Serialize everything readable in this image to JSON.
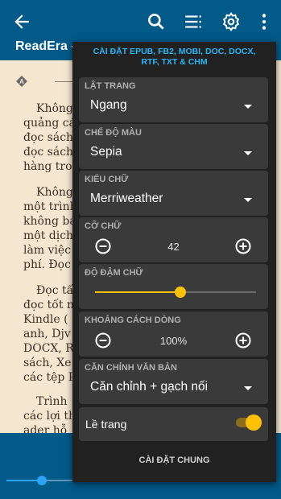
{
  "app_bar": {
    "title": "ReadEra –"
  },
  "book": {
    "lines": [
      "Không",
      "quảng cá",
      "đọc sách",
      "đọc sách",
      "hàng trong",
      "Không",
      "một trình",
      "không bá",
      "một dịch",
      "làm việc",
      "phí. Đọc",
      "Đọc tấ",
      "đọc tốt n",
      "Kindle (",
      "anh, Djv",
      "DOCX, R",
      "sách, Xe",
      "các tệp P",
      "Trình",
      "các lợi th",
      "ader hỗ"
    ]
  },
  "panel": {
    "header": "CÀI ĐẶT EPUB, FB2, MOBI, DOC, DOCX, RTF, TXT & CHM",
    "page_turn": {
      "label": "LẬT TRANG",
      "value": "Ngang"
    },
    "color_mode": {
      "label": "CHẾ ĐỘ MÀU",
      "value": "Sepia"
    },
    "font": {
      "label": "KIỂU CHỮ",
      "value": "Merriweather"
    },
    "font_size": {
      "label": "CỠ CHỮ",
      "value": "42"
    },
    "font_weight": {
      "label": "ĐỘ ĐẬM CHỮ",
      "level": 0.53
    },
    "line_spacing": {
      "label": "KHOẢNG CÁCH DÒNG",
      "value": "100%"
    },
    "alignment": {
      "label": "CĂN CHỈNH VĂN BẢN",
      "value": "Căn chỉnh + gạch nối"
    },
    "margins": {
      "label": "Lề trang",
      "enabled": true
    },
    "general_button": "CÀI ĐẶT CHUNG"
  },
  "colors": {
    "app_bar": "#015a88",
    "panel": "#212121",
    "card": "#3a3a3a",
    "accent": "#ffc107",
    "header_text": "#29b6f6",
    "page": "#f5e6d0"
  }
}
